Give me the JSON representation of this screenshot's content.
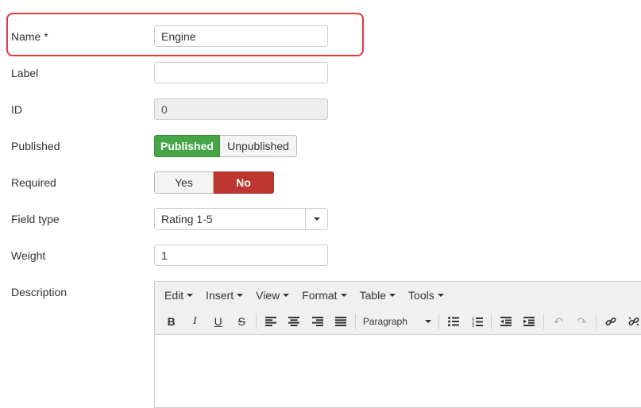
{
  "form": {
    "name": {
      "label": "Name *",
      "value": "Engine"
    },
    "label": {
      "label": "Label",
      "value": ""
    },
    "id": {
      "label": "ID",
      "value": "0"
    },
    "published": {
      "label": "Published",
      "on": "Published",
      "off": "Unpublished",
      "selected": "Published"
    },
    "required": {
      "label": "Required",
      "yes": "Yes",
      "no": "No",
      "selected": "No"
    },
    "field_type": {
      "label": "Field type",
      "value": "Rating 1-5"
    },
    "weight": {
      "label": "Weight",
      "value": "1"
    },
    "description": {
      "label": "Description"
    }
  },
  "editor": {
    "menu": [
      "Edit",
      "Insert",
      "View",
      "Format",
      "Table",
      "Tools"
    ],
    "paragraph": "Paragraph"
  },
  "colors": {
    "published_green": "#46a546",
    "required_no_red": "#bd362f",
    "highlight_border": "#e0393e"
  }
}
